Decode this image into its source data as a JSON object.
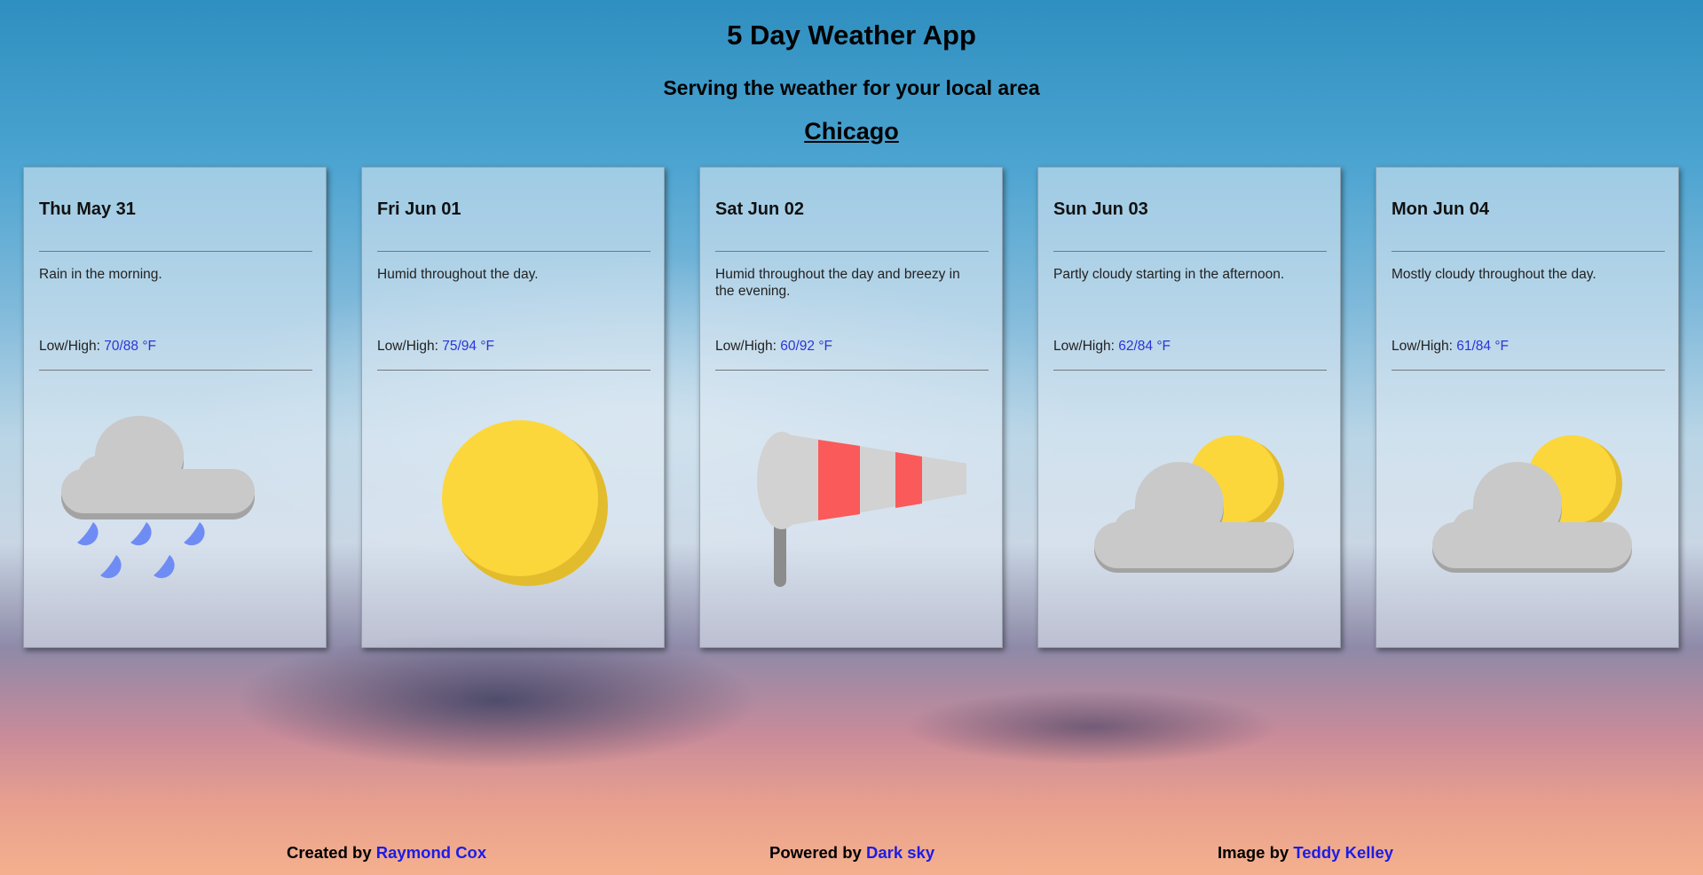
{
  "header": {
    "title": "5 Day Weather App",
    "subtitle": "Serving the weather for your local area",
    "city": "Chicago"
  },
  "forecast": [
    {
      "day": "Thu May 31",
      "summary": "Rain in the morning.",
      "lowhigh_label": "Low/High:",
      "temps": "70/88 °F",
      "icon": "rain-icon"
    },
    {
      "day": "Fri Jun 01",
      "summary": "Humid throughout the day.",
      "lowhigh_label": "Low/High:",
      "temps": "75/94 °F",
      "icon": "sun-icon"
    },
    {
      "day": "Sat Jun 02",
      "summary": "Humid throughout the day and breezy in the evening.",
      "lowhigh_label": "Low/High:",
      "temps": "60/92 °F",
      "icon": "windsock-icon"
    },
    {
      "day": "Sun Jun 03",
      "summary": "Partly cloudy starting in the afternoon.",
      "lowhigh_label": "Low/High:",
      "temps": "62/84 °F",
      "icon": "partly-cloudy-icon"
    },
    {
      "day": "Mon Jun 04",
      "summary": "Mostly cloudy throughout the day.",
      "lowhigh_label": "Low/High:",
      "temps": "61/84 °F",
      "icon": "partly-cloudy-icon"
    }
  ],
  "footer": {
    "created_prefix": "Created by",
    "created_link": "Raymond Cox",
    "powered_prefix": "Powered by",
    "powered_link": "Dark sky",
    "image_prefix": "Image by",
    "image_link": "Teddy Kelley"
  },
  "colors": {
    "link": "#1c1ce6",
    "temperature": "#2a35d6",
    "sun": "#fcd73c",
    "cloud": "#c9c9c9",
    "rain": "#6f8cf5",
    "windsock_stripe": "#fa5a5a"
  }
}
